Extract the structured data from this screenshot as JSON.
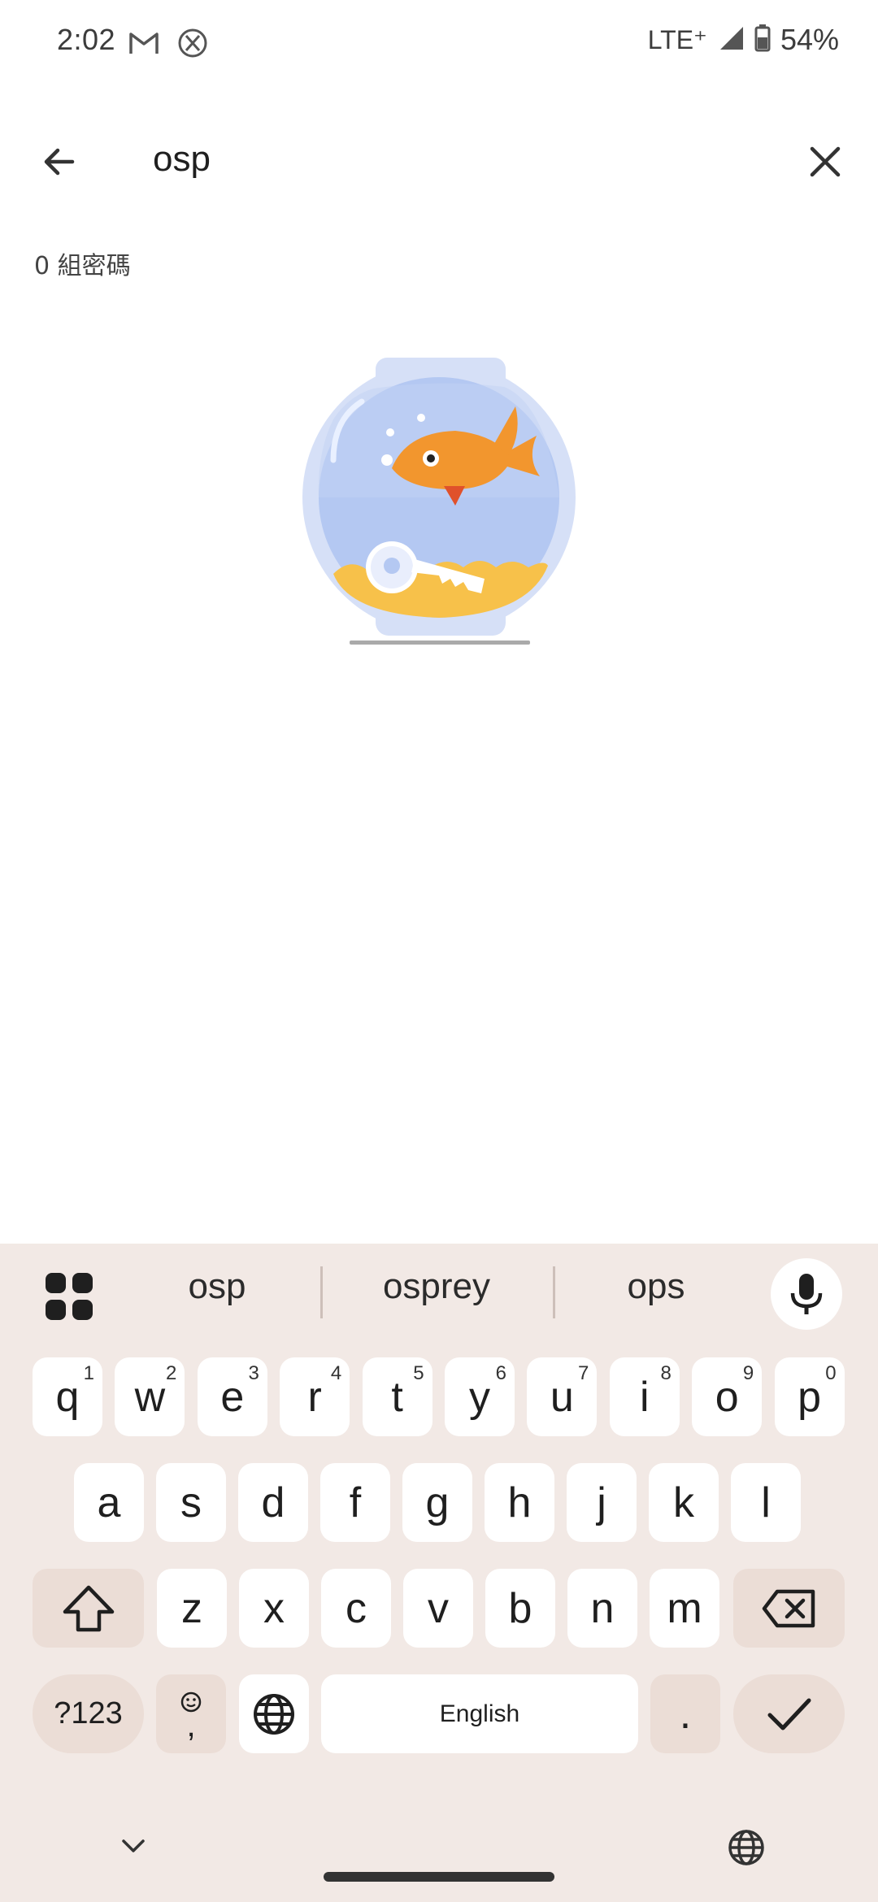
{
  "status": {
    "time": "2:02",
    "network": "LTE⁺",
    "battery": "54%"
  },
  "search": {
    "query": "osp"
  },
  "results": {
    "count_label": "0 組密碼"
  },
  "keyboard": {
    "suggestions": [
      "osp",
      "osprey",
      "ops"
    ],
    "row1": [
      {
        "k": "q",
        "h": "1"
      },
      {
        "k": "w",
        "h": "2"
      },
      {
        "k": "e",
        "h": "3"
      },
      {
        "k": "r",
        "h": "4"
      },
      {
        "k": "t",
        "h": "5"
      },
      {
        "k": "y",
        "h": "6"
      },
      {
        "k": "u",
        "h": "7"
      },
      {
        "k": "i",
        "h": "8"
      },
      {
        "k": "o",
        "h": "9"
      },
      {
        "k": "p",
        "h": "0"
      }
    ],
    "row2": [
      "a",
      "s",
      "d",
      "f",
      "g",
      "h",
      "j",
      "k",
      "l"
    ],
    "row3": [
      "z",
      "x",
      "c",
      "v",
      "b",
      "n",
      "m"
    ],
    "symbols_label": "?123",
    "comma_label": ",",
    "space_label": "English",
    "period_label": "."
  }
}
